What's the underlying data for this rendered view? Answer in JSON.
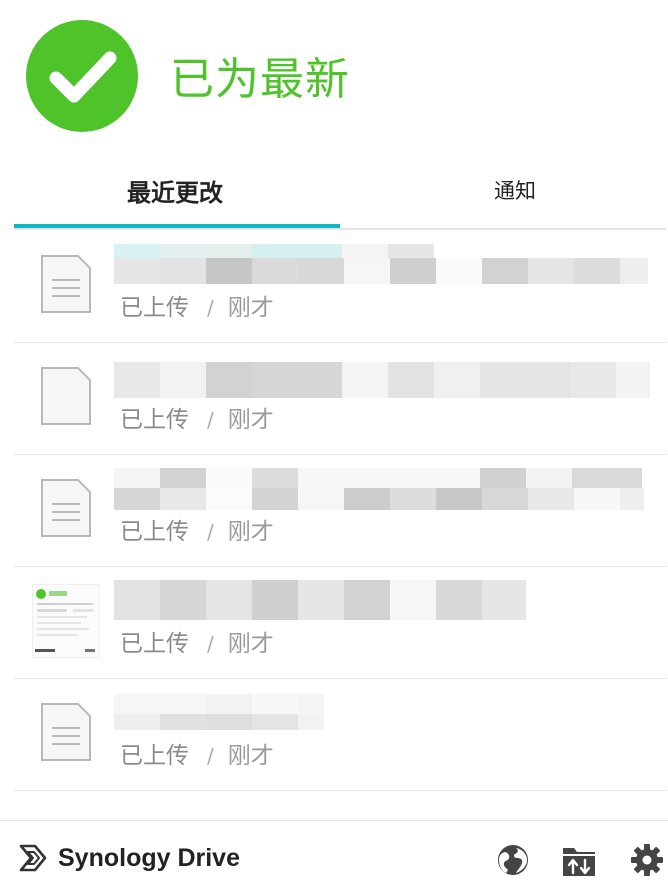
{
  "header": {
    "status_text": "已为最新"
  },
  "tabs": [
    {
      "label": "最近更改",
      "active": true
    },
    {
      "label": "通知",
      "active": false
    }
  ],
  "files": [
    {
      "icon": "document-icon",
      "status": "已上传",
      "separator": "/",
      "time": "刚才"
    },
    {
      "icon": "blank-file-icon",
      "status": "已上传",
      "separator": "/",
      "time": "刚才"
    },
    {
      "icon": "document-icon",
      "status": "已上传",
      "separator": "/",
      "time": "刚才"
    },
    {
      "icon": "image-thumbnail",
      "status": "已上传",
      "separator": "/",
      "time": "刚才"
    },
    {
      "icon": "document-icon",
      "status": "已上传",
      "separator": "/",
      "time": "刚才"
    }
  ],
  "footer": {
    "brand": "Synology Drive",
    "icons": [
      "globe-icon",
      "sync-folder-icon",
      "gear-icon"
    ]
  },
  "colors": {
    "success": "#4fc32a",
    "tab_accent": "#10b8c4"
  }
}
